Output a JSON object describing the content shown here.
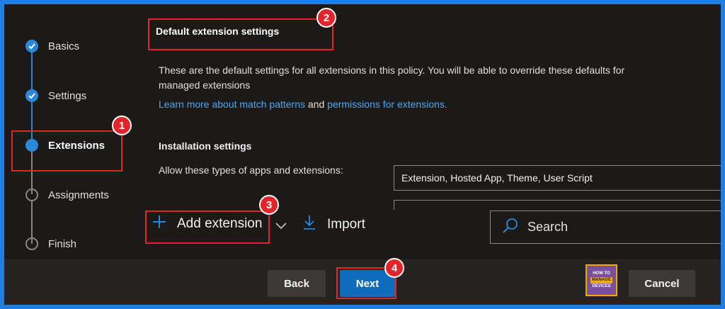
{
  "wizard": {
    "steps": [
      {
        "label": "Basics",
        "state": "done"
      },
      {
        "label": "Settings",
        "state": "done"
      },
      {
        "label": "Extensions",
        "state": "current"
      },
      {
        "label": "Assignments",
        "state": "todo"
      },
      {
        "label": "Finish",
        "state": "todo"
      }
    ]
  },
  "content": {
    "section_title": "Default extension settings",
    "description_line1": "These are the default settings for all extensions in this policy. You will be able to override these defaults for",
    "description_line2": "managed extensions",
    "link_match_patterns": "Learn more about match patterns",
    "and_text": "and",
    "link_permissions": "permissions for extensions.",
    "installation_heading": "Installation settings",
    "allow_types_label": "Allow these types of apps and extensions:",
    "allow_types_value": "Extension, Hosted App, Theme, User Script"
  },
  "commandbar": {
    "add_extension_label": "Add extension",
    "import_label": "Import",
    "search_placeholder": "Search"
  },
  "footer": {
    "back_label": "Back",
    "next_label": "Next",
    "cancel_label": "Cancel",
    "logo_line1": "HOW TO",
    "logo_line2": "MANAGE",
    "logo_line3": "DEVICES"
  },
  "callouts": [
    "1",
    "2",
    "3",
    "4"
  ],
  "colors": {
    "accent": "#2b88d8",
    "callout": "#e3242b",
    "link": "#4aa7f5",
    "primary_button": "#0f6cbd"
  }
}
